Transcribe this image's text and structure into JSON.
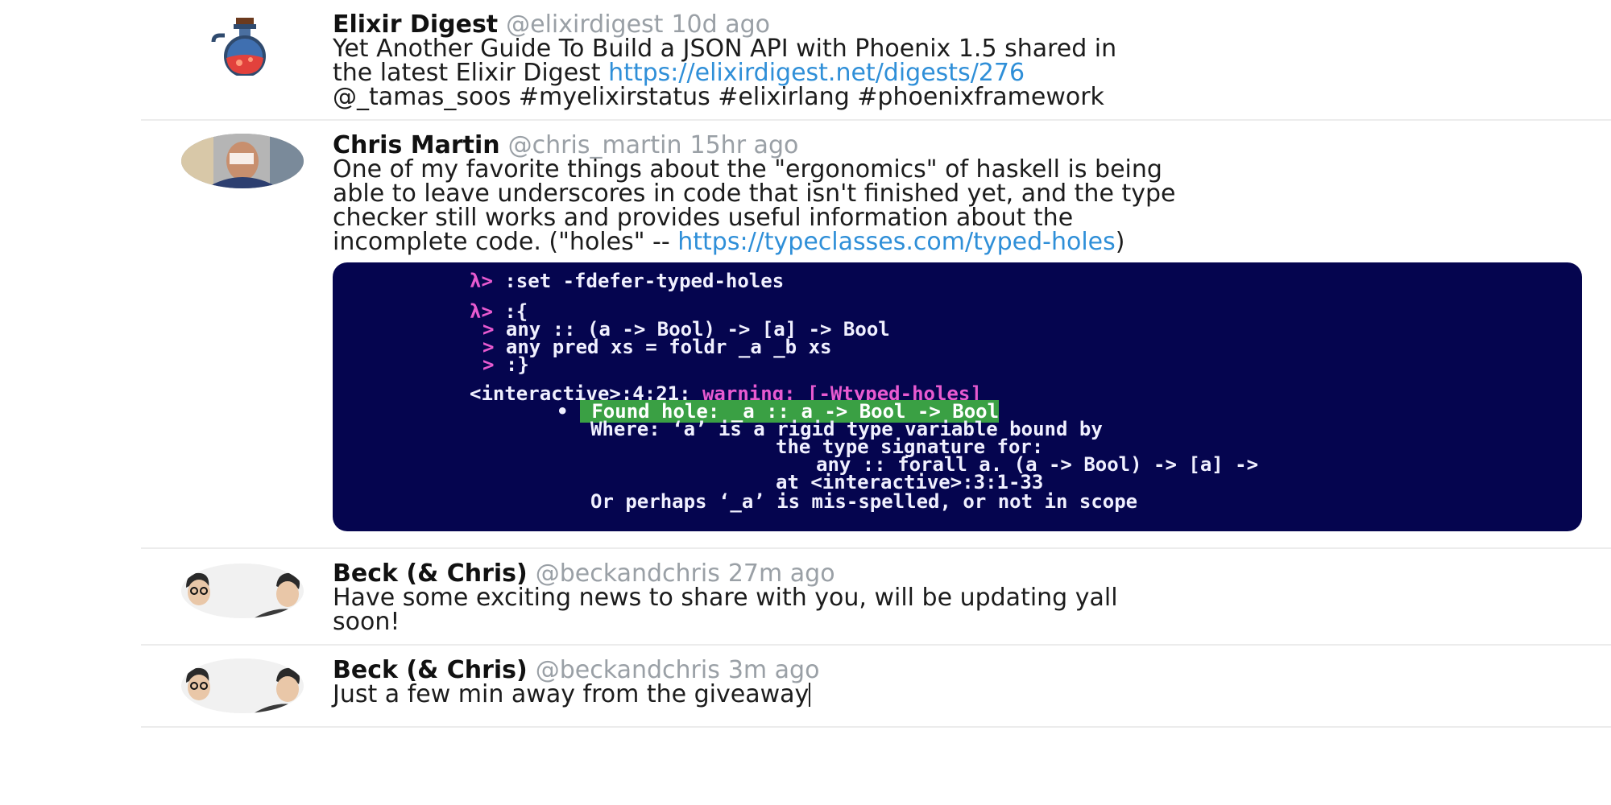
{
  "tweets": [
    {
      "name": "Elixir Digest",
      "handle": "@elixirdigest",
      "time": "10d ago",
      "avatar_icon": "potion-bottle-icon",
      "line1": "Yet Another Guide To Build a JSON API with Phoenix 1.5 shared in",
      "line2_text": "the latest Elixir Digest ",
      "line2_link": "https://elixirdigest.net/digests/276",
      "line3": "@_tamas_soos #myelixirstatus #elixirlang #phoenixframework"
    },
    {
      "name": "Chris Martin",
      "handle": "@chris_martin",
      "time": "15hr ago",
      "avatar_icon": "person-photo-icon",
      "line1": "One of my favorite things about the \"ergonomics\" of haskell is being",
      "line2": "able to leave underscores in code that isn't finished yet, and the type",
      "line3": "checker still works and provides useful information about the",
      "line4_text": "incomplete code. (\"holes\" -- ",
      "line4_link": "https://typeclasses.com/typed-holes",
      "line4_end": ")",
      "code": {
        "prompt": "λ>",
        "cmd1": " :set -fdefer-typed-holes",
        "cmd2": " :{",
        "cont": ">",
        "c1": " any :: (a -> Bool) -> [a] -> Bool",
        "c2": " any pred xs = foldr _a _b xs",
        "c3": " :}",
        "loc": "<interactive>:4:21: ",
        "warning": "warning: ",
        "flag": "[-Wtyped-holes]",
        "bullet": "•",
        "found": " Found hole: _a :: a -> Bool -> Bool",
        "where": "Where: ‘a’ is a rigid type variable bound by",
        "sig": "the type signature for:",
        "anysig": "any :: forall a. (a -> Bool) -> [a] ->",
        "at": "at <interactive>:3:1-33",
        "perhaps": "Or perhaps ‘_a’ is mis-spelled, or not in scope"
      }
    },
    {
      "name": "Beck (& Chris)",
      "handle": "@beckandchris",
      "time": "27m ago",
      "avatar_icon": "two-faces-icon",
      "line1": "Have some exciting news to share with you, will be updating yall",
      "line2": "soon!"
    },
    {
      "name": "Beck (& Chris)",
      "handle": "@beckandchris",
      "time": "3m ago",
      "avatar_icon": "two-faces-icon",
      "line1": "Just a few min away from the giveaway"
    }
  ]
}
